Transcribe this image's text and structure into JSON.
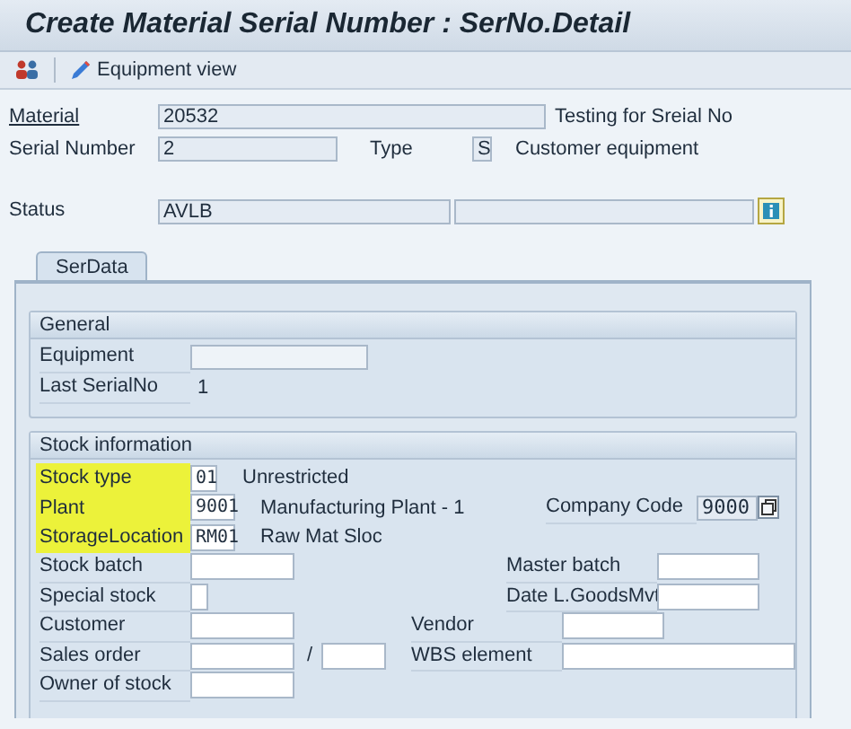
{
  "window": {
    "title": "Create Material Serial Number : SerNo.Detail"
  },
  "toolbar": {
    "button_label": "Equipment view"
  },
  "header": {
    "material": {
      "label": "Material",
      "value": "20532",
      "description": "Testing for Sreial No"
    },
    "serial_number": {
      "label": "Serial Number",
      "value": "2"
    },
    "type": {
      "label": "Type",
      "value": "S",
      "description": "Customer equipment"
    },
    "status": {
      "label": "Status",
      "value": "AVLB"
    }
  },
  "tabs": [
    {
      "label": "SerData",
      "selected": true
    }
  ],
  "general": {
    "title": "General",
    "fields": [
      {
        "label": "Equipment",
        "kind": "input"
      },
      {
        "label": "Last SerialNo",
        "kind": "text",
        "value": "1"
      }
    ]
  },
  "stock_information": {
    "title": "Stock information",
    "rows": [
      {
        "label": "Stock type",
        "highlighted": true,
        "value": "01",
        "description": "Unrestricted"
      },
      {
        "label": "Plant",
        "highlighted": true,
        "value": "9001",
        "description": "Manufacturing Plant - 1",
        "right": {
          "label": "Company Code",
          "value": "9000"
        }
      },
      {
        "label": "StorageLocation",
        "highlighted": true,
        "value": "RM01",
        "description": "Raw Mat Sloc"
      },
      {
        "label": "Stock batch",
        "highlighted": false,
        "right": {
          "label": "Master batch"
        }
      },
      {
        "label": "Special stock",
        "highlighted": false,
        "right": {
          "label": "Date L.GoodsMvt"
        }
      },
      {
        "label": "Customer",
        "highlighted": false,
        "middle": {
          "label": "Vendor"
        }
      },
      {
        "label": "Sales order",
        "highlighted": false,
        "separator": "/",
        "middle": {
          "label": "WBS element"
        }
      },
      {
        "label": "Owner of stock",
        "highlighted": false
      }
    ]
  }
}
